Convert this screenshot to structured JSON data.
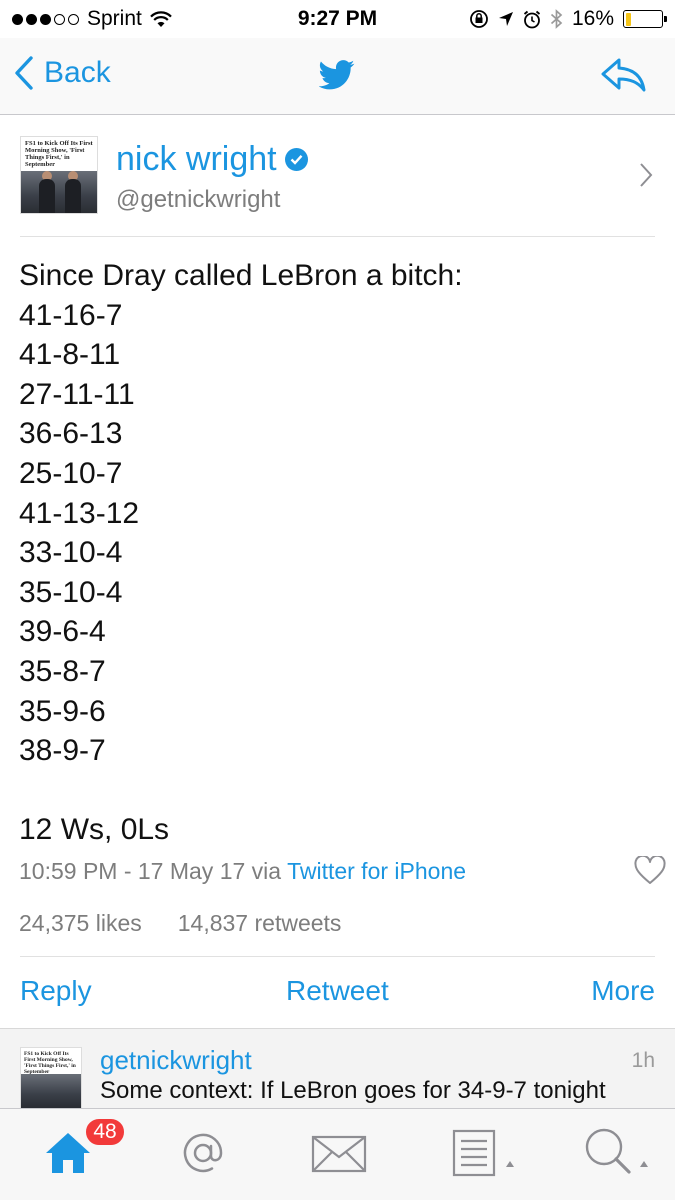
{
  "status_bar": {
    "carrier": "Sprint",
    "time": "9:27 PM",
    "battery": "16%",
    "battery_level": 0.16
  },
  "nav": {
    "back_label": "Back"
  },
  "tweet": {
    "display_name": "nick wright",
    "handle": "@getnickwright",
    "avatar_headline": "FS1 to Kick Off Its First Morning Show, 'First Things First,' in September",
    "lines": [
      "Since Dray called LeBron a bitch:",
      "41-16-7",
      "41-8-11",
      "27-11-11",
      "36-6-13",
      "25-10-7",
      "41-13-12",
      "33-10-4",
      "35-10-4",
      "39-6-4",
      "35-8-7",
      "35-9-6",
      "38-9-7",
      "",
      "12 Ws, 0Ls"
    ],
    "timestamp": "10:59 PM - 17 May 17 via ",
    "source": "Twitter for iPhone",
    "likes": "24,375 likes",
    "retweets": "14,837 retweets"
  },
  "actions": {
    "reply": "Reply",
    "retweet": "Retweet",
    "more": "More"
  },
  "reply_preview": {
    "name": "getnickwright",
    "time": "1h",
    "text": "Some context: If LeBron goes for 34-9-7 tonight",
    "avatar_headline": "FS1 to Kick Off Its First Morning Show, 'First Things First,' in September"
  },
  "tab_bar": {
    "badge": "48",
    "tabs": [
      "home-icon",
      "mentions-icon",
      "messages-icon",
      "lists-icon",
      "search-icon"
    ]
  },
  "colors": {
    "twitter_blue": "#1b95e0",
    "badge_red": "#f23a3a",
    "battery_yellow": "#f5c518"
  }
}
